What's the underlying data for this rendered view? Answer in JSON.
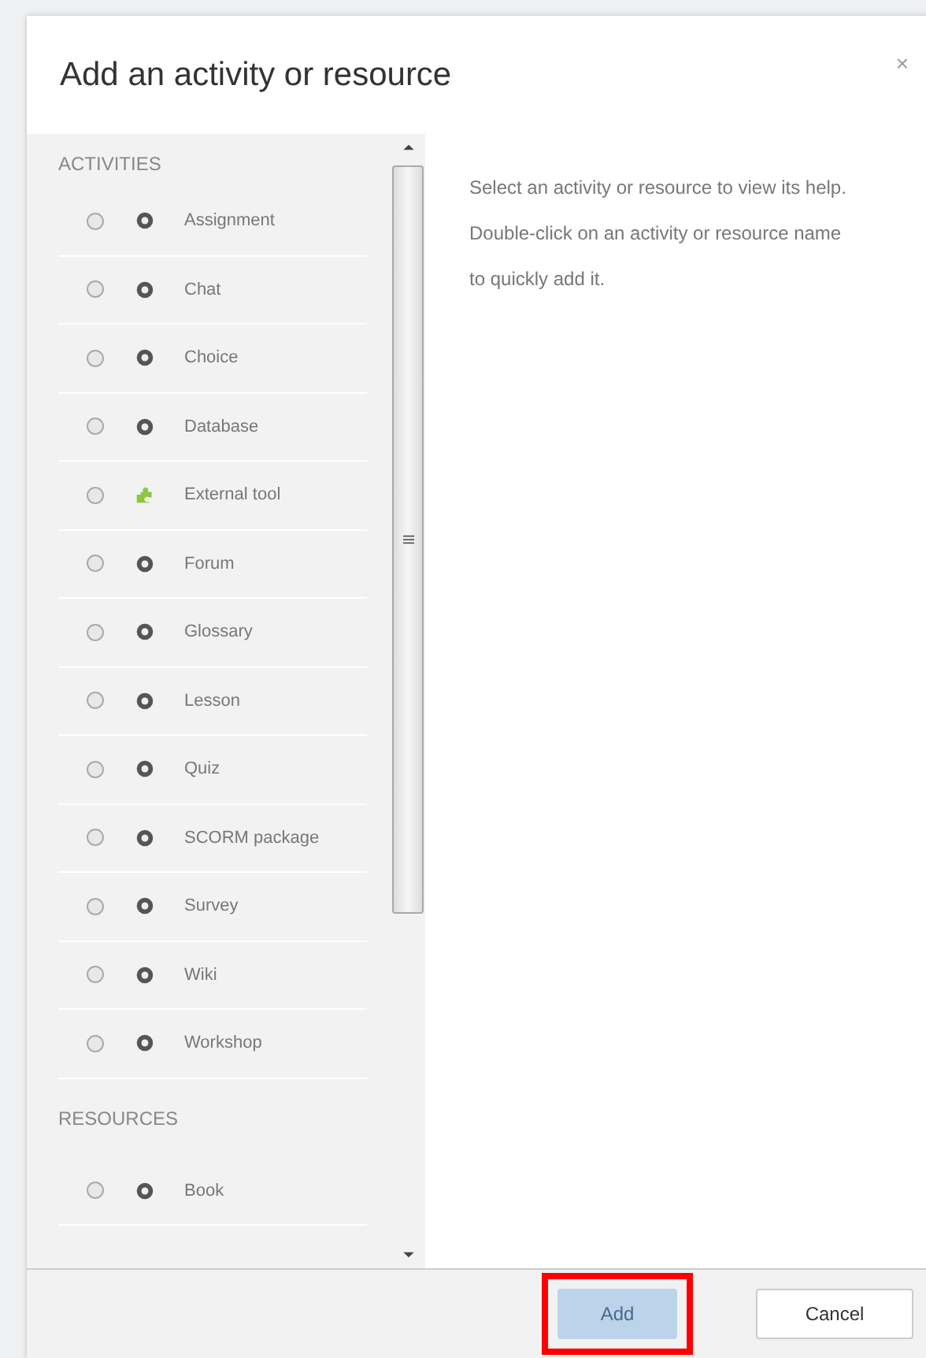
{
  "dialog": {
    "title": "Add an activity or resource",
    "close": "×"
  },
  "sections": [
    {
      "heading": "ACTIVITIES",
      "items": [
        {
          "label": "Assignment",
          "kind": "module",
          "selected": false
        },
        {
          "label": "Chat",
          "kind": "module",
          "selected": false
        },
        {
          "label": "Choice",
          "kind": "module",
          "selected": false
        },
        {
          "label": "Database",
          "kind": "module",
          "selected": false
        },
        {
          "label": "External tool",
          "kind": "plugin",
          "selected": false
        },
        {
          "label": "Forum",
          "kind": "module",
          "selected": false
        },
        {
          "label": "Glossary",
          "kind": "module",
          "selected": false
        },
        {
          "label": "Lesson",
          "kind": "module",
          "selected": false
        },
        {
          "label": "Quiz",
          "kind": "module",
          "selected": false
        },
        {
          "label": "SCORM package",
          "kind": "module",
          "selected": false
        },
        {
          "label": "Survey",
          "kind": "module",
          "selected": false
        },
        {
          "label": "Wiki",
          "kind": "module",
          "selected": false
        },
        {
          "label": "Workshop",
          "kind": "module",
          "selected": false
        }
      ]
    },
    {
      "heading": "RESOURCES",
      "items": [
        {
          "label": "Book",
          "kind": "module",
          "selected": false
        }
      ]
    }
  ],
  "help_text": "Select an activity or resource to view its help. Double-click on an activity or resource name to quickly add it.",
  "buttons": [
    {
      "label": "Add",
      "disabled": true,
      "highlighted": true
    },
    {
      "label": "Cancel",
      "disabled": false,
      "highlighted": false
    }
  ]
}
